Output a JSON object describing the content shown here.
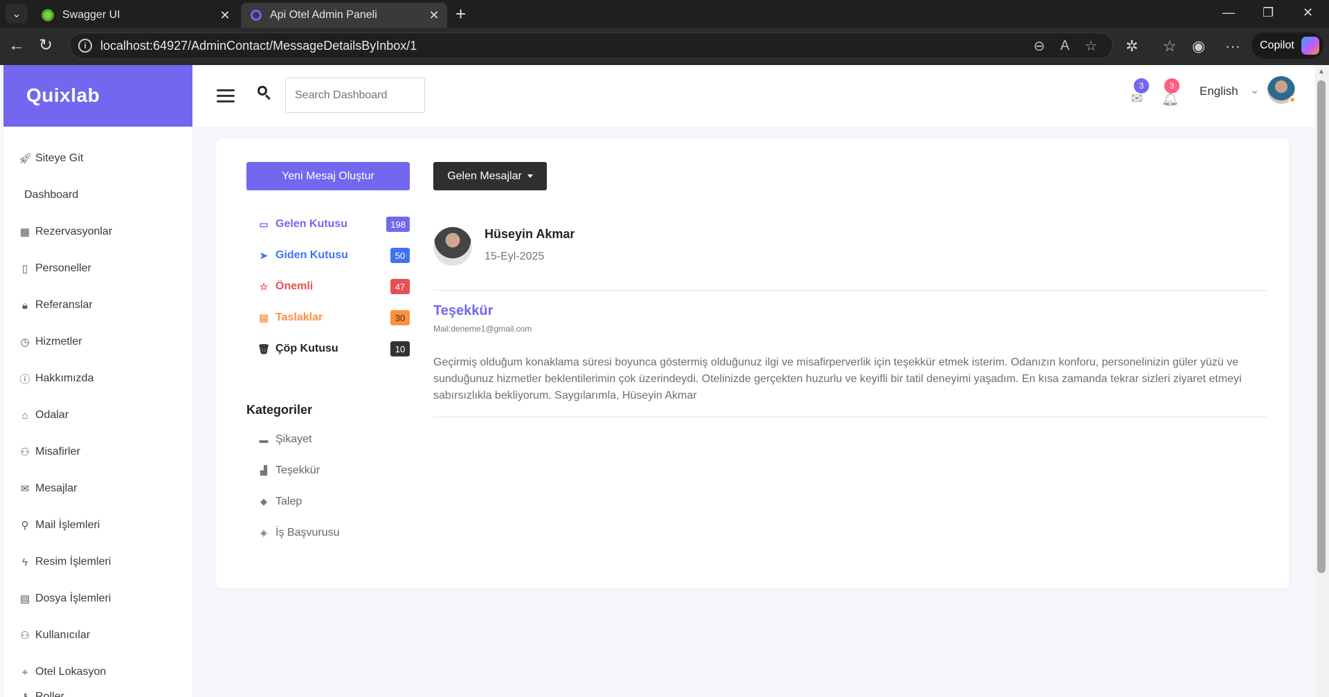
{
  "browser": {
    "tabs": [
      {
        "title": "Swagger UI"
      },
      {
        "title": "Api Otel Admin Paneli"
      }
    ],
    "url": "localhost:64927/AdminContact/MessageDetailsByInbox/1",
    "copilot_label": "Copilot"
  },
  "sidebar": {
    "brand": "Quixlab",
    "items": [
      {
        "label": "Siteye Git",
        "icon": "rocket-icon"
      },
      {
        "label": "Dashboard",
        "icon": ""
      },
      {
        "label": "Rezervasyonlar",
        "icon": "calendar-icon"
      },
      {
        "label": "Personeller",
        "icon": "mobile-icon"
      },
      {
        "label": "Referanslar",
        "icon": "lock-icon"
      },
      {
        "label": "Hizmetler",
        "icon": "clock-icon"
      },
      {
        "label": "Hakkımızda",
        "icon": "info-icon"
      },
      {
        "label": "Odalar",
        "icon": "home-icon"
      },
      {
        "label": "Misafirler",
        "icon": "user-icon"
      },
      {
        "label": "Mesajlar",
        "icon": "envelope-icon"
      },
      {
        "label": "Mail İşlemleri",
        "icon": "paperclip-icon"
      },
      {
        "label": "Resim İşlemleri",
        "icon": "lightning-icon"
      },
      {
        "label": "Dosya İşlemleri",
        "icon": "film-icon"
      },
      {
        "label": "Kullanıcılar",
        "icon": "user-icon"
      },
      {
        "label": "Otel Lokasyon",
        "icon": "pin-icon"
      },
      {
        "label": "Roller",
        "icon": "key-icon"
      }
    ]
  },
  "topbar": {
    "search_placeholder": "Search Dashboard",
    "mail_count": "3",
    "notification_count": "3",
    "language": "English",
    "colors": {
      "mail_badge": "#7367f0",
      "notification_badge": "#ff5e7e"
    }
  },
  "mailbox": {
    "new_message_label": "Yeni Mesaj Oluştur",
    "inbox_menu_label": "Gelen Mesajlar",
    "folders": [
      {
        "label": "Gelen Kutusu",
        "count": "198",
        "color": "#7367f0",
        "icon": "inbox-icon"
      },
      {
        "label": "Giden Kutusu",
        "count": "50",
        "color": "#4073f0",
        "icon": "send-icon"
      },
      {
        "label": "Önemli",
        "count": "47",
        "color": "#ea4f4f",
        "icon": "star-icon"
      },
      {
        "label": "Taslaklar",
        "count": "30",
        "color": "#ff8f3f",
        "icon": "draft-icon"
      },
      {
        "label": "Çöp Kutusu",
        "count": "10",
        "color": "#333333",
        "icon": "trash-icon"
      }
    ],
    "categories_title": "Kategoriler",
    "categories": [
      {
        "label": "Şikayet",
        "icon": "briefcase-icon"
      },
      {
        "label": "Teşekkür",
        "icon": "chart-icon"
      },
      {
        "label": "Talep",
        "icon": "tag-icon"
      },
      {
        "label": "İş Başvurusu",
        "icon": "tags-icon"
      }
    ]
  },
  "message": {
    "sender_name": "Hüseyin Akmar",
    "date": "15-Eyl-2025",
    "subject": "Teşekkür",
    "mail": "Mail:deneme1@gmail.com",
    "body": "Geçirmiş olduğum konaklama süresi boyunca göstermiş olduğunuz ilgi ve misafirperverlik için teşekkür etmek isterim. Odanızın konforu, personelinizin güler yüzü ve sunduğunuz hizmetler beklentilerimin çok üzerindeydi. Otelinizde gerçekten huzurlu ve keyifli bir tatil deneyimi yaşadım. En kısa zamanda tekrar sizleri ziyaret etmeyi sabırsızlıkla bekliyorum. Saygılarımla, Hüseyin Akmar"
  }
}
